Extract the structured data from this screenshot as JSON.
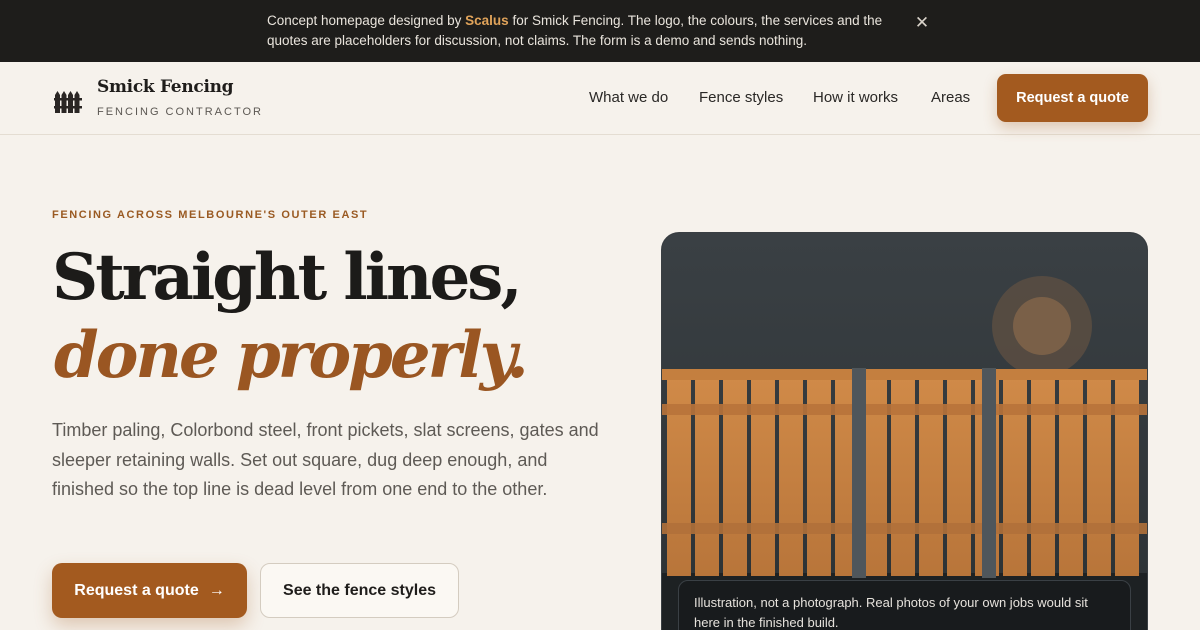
{
  "notice": {
    "prefix": "Concept homepage designed by ",
    "brand": "Scalus",
    "suffix": " for Smick Fencing. The logo, the colours, the services and the quotes are placeholders for discussion, not claims. The form is a demo and sends nothing.",
    "close_icon": "close-icon",
    "close_glyph": "✕"
  },
  "header": {
    "logo_icon": "fence-icon",
    "brand_name": "Smick Fencing",
    "tagline": "FENCING CONTRACTOR",
    "nav": [
      "What we do",
      "Fence styles",
      "How it works",
      "Areas"
    ],
    "cta": "Request a quote"
  },
  "hero": {
    "eyebrow": "FENCING ACROSS MELBOURNE'S OUTER EAST",
    "title_line1": "Straight lines,",
    "title_line2": "done properly.",
    "lead": "Timber paling, Colorbond steel, front pickets, slat screens, gates and sleeper retaining walls. Set out square, dug deep enough, and finished so the top line is dead level from one end to the other.",
    "primary_cta": "Request a quote",
    "primary_icon": "arrow-right-icon",
    "arrow_glyph": "→",
    "secondary_cta": "See the fence styles"
  },
  "illustration": {
    "caption": "Illustration, not a photograph. Real photos of your own jobs would sit here in the finished build.",
    "colors": {
      "sky": "#343a3e",
      "timber": "#c9823f",
      "post": "#4f565b",
      "sun": "#7a6048"
    }
  }
}
